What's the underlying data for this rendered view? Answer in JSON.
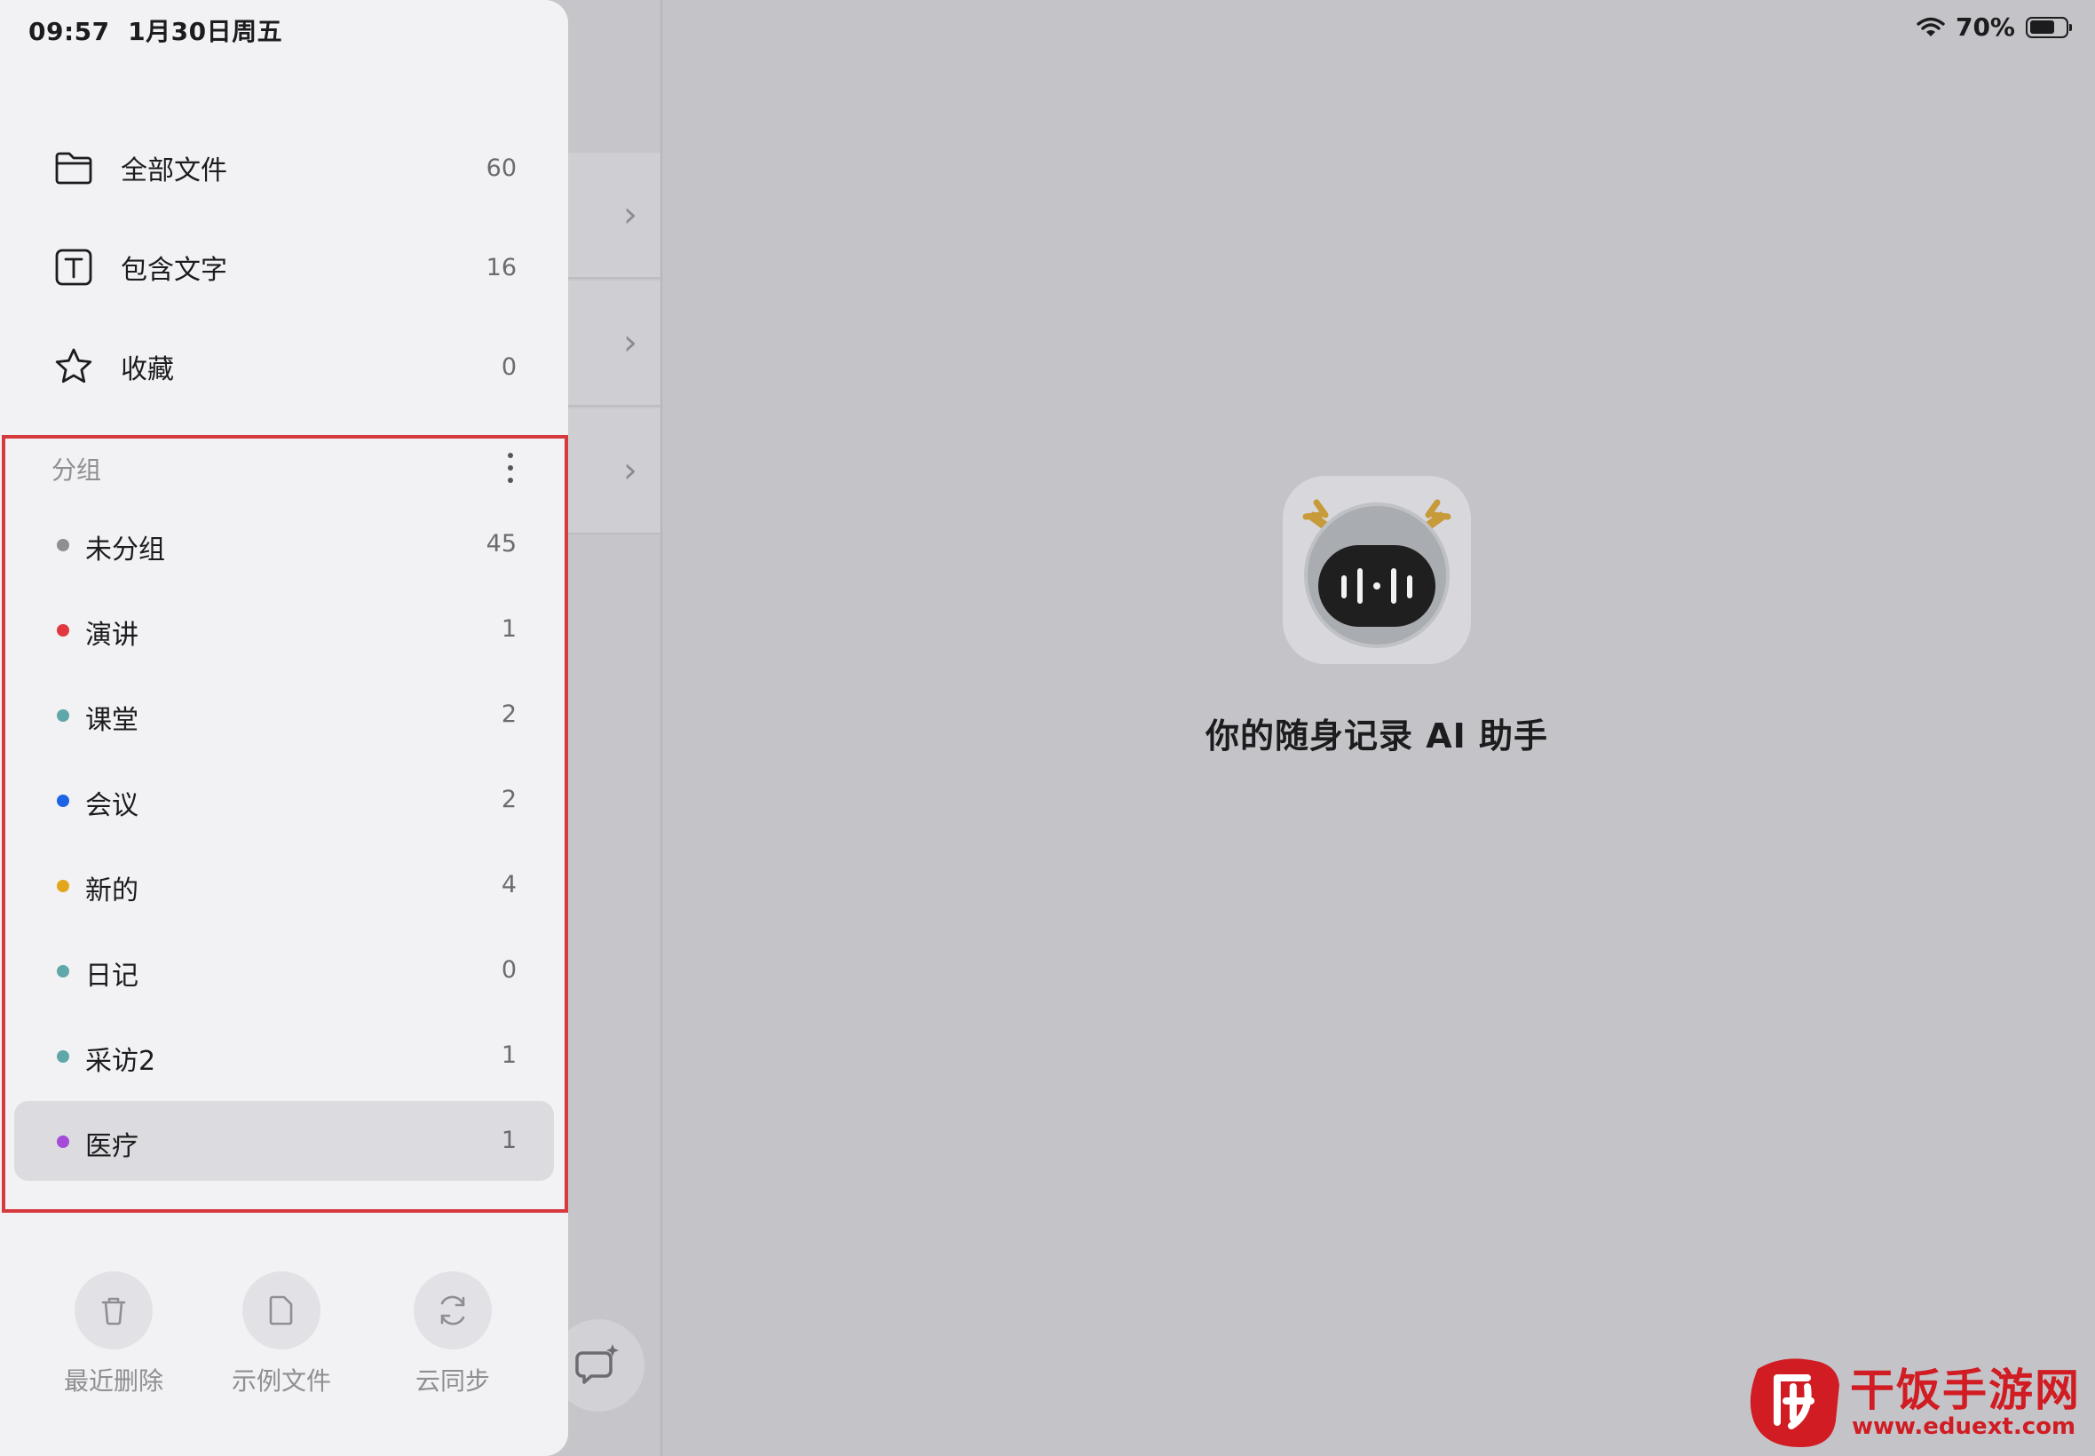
{
  "status_bar": {
    "time": "09:57",
    "date": "1月30日周五",
    "battery": "70%",
    "battery_level": 0.7
  },
  "sidebar": {
    "nav": [
      {
        "label": "全部文件",
        "count": "60",
        "icon": "folder-icon"
      },
      {
        "label": "包含文字",
        "count": "16",
        "icon": "text-icon"
      },
      {
        "label": "收藏",
        "count": "0",
        "icon": "star-icon"
      }
    ],
    "group_header": "分组",
    "groups": [
      {
        "label": "未分组",
        "count": "45",
        "color": "#8e8e93",
        "selected": false
      },
      {
        "label": "演讲",
        "count": "1",
        "color": "#e0383e",
        "selected": false
      },
      {
        "label": "课堂",
        "count": "2",
        "color": "#5fa7a9",
        "selected": false
      },
      {
        "label": "会议",
        "count": "2",
        "color": "#1c63e6",
        "selected": false
      },
      {
        "label": "新的",
        "count": "4",
        "color": "#e3a51c",
        "selected": false
      },
      {
        "label": "日记",
        "count": "0",
        "color": "#5fa7a9",
        "selected": false
      },
      {
        "label": "采访2",
        "count": "1",
        "color": "#5fa7a9",
        "selected": false
      },
      {
        "label": "医疗",
        "count": "1",
        "color": "#a64bd8",
        "selected": true
      }
    ],
    "bottom_actions": [
      {
        "label": "最近删除",
        "icon": "trash-icon"
      },
      {
        "label": "示例文件",
        "icon": "document-icon"
      },
      {
        "label": "云同步",
        "icon": "sync-icon"
      }
    ]
  },
  "main": {
    "empty_title": "你的随身记录 AI 助手"
  },
  "watermark": {
    "text": "干饭手游网",
    "url": "www.eduext.com"
  },
  "colors": {
    "highlight_border": "#d63a3f",
    "watermark": "#d01c22"
  }
}
